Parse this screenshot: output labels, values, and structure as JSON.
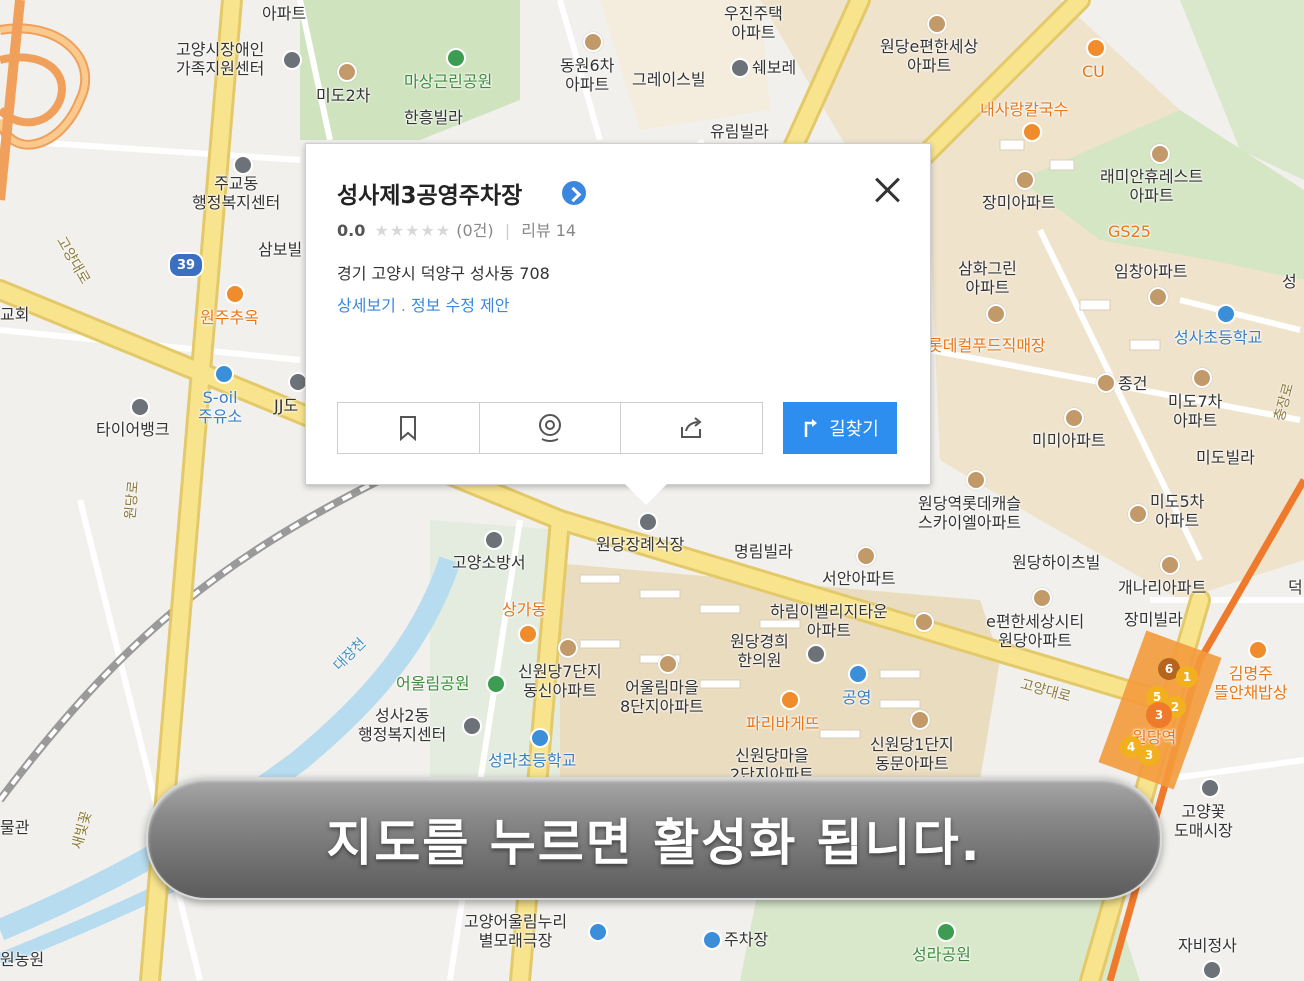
{
  "popup": {
    "title": "성사제3공영주차장",
    "score": "0.0",
    "stars": "★★★★★",
    "review_count": "(0건)",
    "review_label": "리뷰 14",
    "address": "경기 고양시 덕양구 성사동 708",
    "link_detail": "상세보기",
    "link_dot": ".",
    "link_edit": "정보 수정 제안",
    "route_label": "길찾기"
  },
  "banner": {
    "text": "지도를 누르면 활성화 됩니다."
  },
  "map_labels": {
    "apt_top": "아파트",
    "goyang_center": "고양시장애인\n가족지원센터",
    "mido2": "미도2차",
    "masang_park": "마상근린공원",
    "hanheung": "한흥빌라",
    "dongwon6": "동원6차\n아파트",
    "grace": "그레이스빌",
    "woojin": "우진주택\n아파트",
    "shwebore": "쉐보레",
    "yurim": "유림빌라",
    "wondang_e": "원당e편한세상\n아파트",
    "cu": "CU",
    "naesarang": "내사랑칼국수",
    "jugyo": "주교동\n행정복지센터",
    "samboh": "삼보빌",
    "church": "교회",
    "wonju": "원주추옥",
    "soil": "S-oil\n주유소",
    "jj": "JJ도",
    "tire": "타이어뱅크",
    "jangmi_apt": "장미아파트",
    "raemian": "래미안휴레스트\n아파트",
    "gs25": "GS25",
    "samhwa": "삼화그린\n아파트",
    "imchang": "임창아파트",
    "seongsa_elem": "성사초등학교",
    "lotte_food": "롯데컬푸드직매장",
    "jonggeon": "종건",
    "mido7": "미도7차\n아파트",
    "mimi": "미미아파트",
    "mido_villa": "미도빌라",
    "wondang_lotte": "원당역롯데캐슬\n스카이엘아파트",
    "mido5": "미도5차\n아파트",
    "wondang_hall": "원당장례식장",
    "myungrim": "명림빌라",
    "goyang_fire": "고양소방서",
    "seoan": "서안아파트",
    "wondang_heights": "원당하이츠빌",
    "gaenari": "개나리아파트",
    "sangga": "상가동",
    "harim": "하림이벨리지타운\n아파트",
    "e_city": "e편한세상시티\n원당아파트",
    "jangmi_villa": "장미빌라",
    "clinic": "원당경희\n한의원",
    "parking_pub": "공영",
    "sinwon7": "신원당7단지\n동신아파트",
    "eoulrim8": "어울림마을\n8단지아파트",
    "eoulrim_park": "어울림공원",
    "paris": "파리바게뜨",
    "kimmyeongju": "김명주\n뜰안채밥상",
    "seongsa2": "성사2동\n행정복지센터",
    "seongra_elem": "성라초등학교",
    "sinwon_maeul": "신원당마을\n2단지아파트",
    "sinwon1": "신원당1단지\n동문아파트",
    "wondang_stn": "원당역",
    "goyang_flower": "고양꽃\n도매시장",
    "mulgwan": "물관",
    "goyang_eoulrim": "고양어울림누리\n별모래극장",
    "parking": "주차장",
    "seongra_park": "성라공원",
    "jabi": "자비정사",
    "wonnong": "원농원",
    "deok": "덕",
    "seong": "성",
    "road_39": "39"
  },
  "road_labels": {
    "goyang_daero_left": "고양대로",
    "wondang_ro": "원당로",
    "goyang_daero_right": "고양대로",
    "daejang": "대장천",
    "saebit": "새빛꽃",
    "chungjang": "충장로"
  },
  "colors": {
    "route_button": "#2e8ef0",
    "link_blue": "#3b87e0",
    "major_road": "#f7e08a",
    "residential": "#eee3cf",
    "park": "#cfe4c0",
    "water": "#b7dcef"
  }
}
